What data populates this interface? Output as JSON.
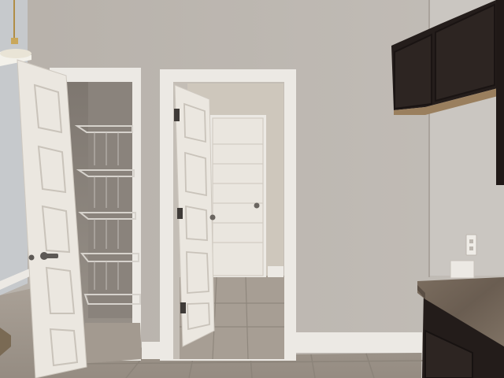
{
  "scene": {
    "subject": "interior-hallway-pantry-laundry",
    "colors": {
      "wall": "#bdb7b1",
      "wall_shadow": "#a9a39c",
      "trim": "#ece9e4",
      "door": "#e8e4dd",
      "door_panel_line": "#c9c3ba",
      "floor": "#a49b91",
      "floor_grout": "#8c847a",
      "cabinet": "#2a2220",
      "countertop": "#6f6255",
      "pantry_interior": "#8f8881",
      "shelf_wire": "#d6d2cc",
      "hardware": "#5d5955",
      "pendant_brass": "#c9a75a"
    },
    "icons": [
      "pendant-light-icon",
      "door-knob-icon",
      "door-hinge-icon",
      "wall-outlet-icon"
    ]
  }
}
